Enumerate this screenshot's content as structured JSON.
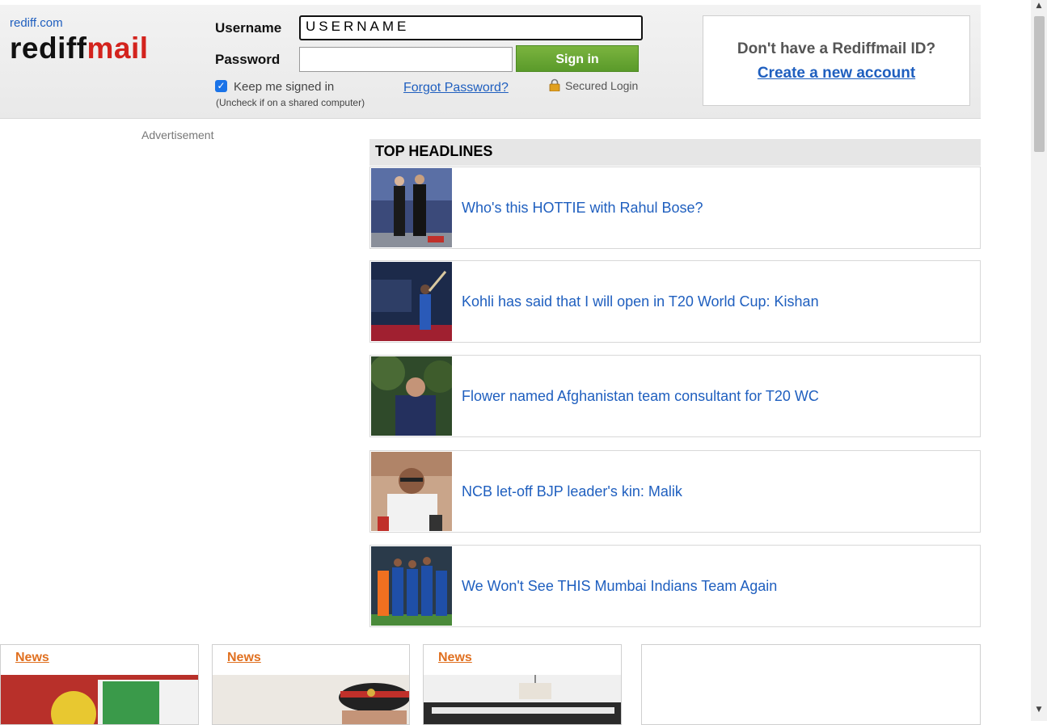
{
  "header": {
    "site_link": "rediff.com",
    "logo_part1": "rediff",
    "logo_part2": "mail",
    "username_label": "Username",
    "username_value": "USERNAME",
    "password_label": "Password",
    "signin_label": "Sign in",
    "keep_signed_in": "Keep me signed in",
    "uncheck_note": "(Uncheck if on a shared computer)",
    "forgot_password": "Forgot Password?",
    "secured_login": "Secured Login"
  },
  "signup": {
    "question": "Don't have a Rediffmail ID?",
    "link": "Create a new account"
  },
  "advertisement_label": "Advertisement",
  "headlines": {
    "title": "TOP HEADLINES",
    "items": [
      {
        "text": "Who's this HOTTIE with Rahul Bose?"
      },
      {
        "text": "Kohli has said that I will open in T20 World Cup: Kishan"
      },
      {
        "text": "Flower named Afghanistan team consultant for T20 WC"
      },
      {
        "text": "NCB let-off BJP leader's kin: Malik"
      },
      {
        "text": "We Won't See THIS Mumbai Indians Team Again"
      }
    ]
  },
  "news_cards": [
    {
      "category": "News"
    },
    {
      "category": "News"
    },
    {
      "category": "News"
    }
  ],
  "colors": {
    "link": "#1f5fbf",
    "brand_red": "#d3231d",
    "signin_green": "#6aa733",
    "news_orange": "#e07020"
  }
}
